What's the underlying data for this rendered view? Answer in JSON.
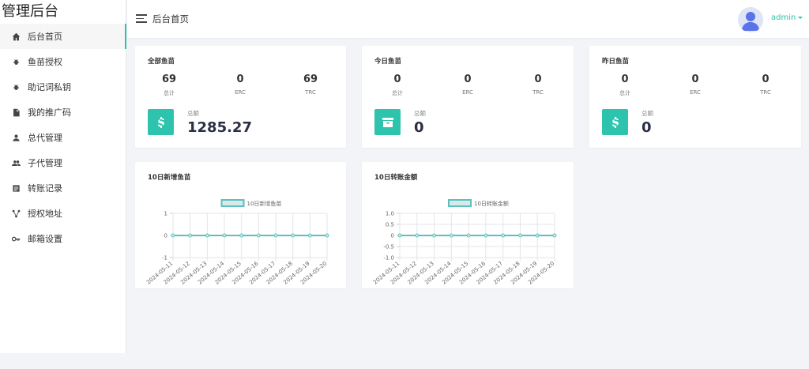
{
  "app": {
    "title": "管理后台"
  },
  "sidebar": {
    "items": [
      {
        "label": "后台首页",
        "icon": "home-icon"
      },
      {
        "label": "鱼苗授权",
        "icon": "bug-icon"
      },
      {
        "label": "助记词私钥",
        "icon": "bug-icon"
      },
      {
        "label": "我的推广码",
        "icon": "file-icon"
      },
      {
        "label": "总代管理",
        "icon": "user-icon"
      },
      {
        "label": "子代管理",
        "icon": "users-icon"
      },
      {
        "label": "转账记录",
        "icon": "list-icon"
      },
      {
        "label": "授权地址",
        "icon": "share-icon"
      },
      {
        "label": "邮箱设置",
        "icon": "key-icon"
      }
    ]
  },
  "header": {
    "page_title": "后台首页",
    "username": "admin"
  },
  "cards": [
    {
      "title": "全部鱼苗",
      "stats": [
        {
          "value": "69",
          "label": "总计"
        },
        {
          "value": "0",
          "label": "ERC"
        },
        {
          "value": "69",
          "label": "TRC"
        }
      ],
      "sum_label": "总额",
      "sum_value": "1285.27",
      "icon": "dollar-icon"
    },
    {
      "title": "今日鱼苗",
      "stats": [
        {
          "value": "0",
          "label": "总计"
        },
        {
          "value": "0",
          "label": "ERC"
        },
        {
          "value": "0",
          "label": "TRC"
        }
      ],
      "sum_label": "总额",
      "sum_value": "0",
      "icon": "archive-icon"
    },
    {
      "title": "昨日鱼苗",
      "stats": [
        {
          "value": "0",
          "label": "总计"
        },
        {
          "value": "0",
          "label": "ERC"
        },
        {
          "value": "0",
          "label": "TRC"
        }
      ],
      "sum_label": "总额",
      "sum_value": "0",
      "icon": "dollar-icon"
    }
  ],
  "colors": {
    "accent": "#2dc3ad",
    "line": "#5bc0be",
    "legend_fill": "#d7e9e8"
  },
  "chart_data": [
    {
      "type": "line",
      "title": "10日新增鱼苗",
      "categories": [
        "2024-05-11",
        "2024-05-12",
        "2024-05-13",
        "2024-05-14",
        "2024-05-15",
        "2024-05-16",
        "2024-05-17",
        "2024-05-18",
        "2024-05-19",
        "2024-05-20"
      ],
      "series": [
        {
          "name": "10日新增鱼苗",
          "values": [
            0,
            0,
            0,
            0,
            0,
            0,
            0,
            0,
            0,
            0
          ]
        }
      ],
      "yticks": [
        "1",
        "0",
        "-1"
      ],
      "ylim": [
        -1,
        1
      ],
      "grid": true,
      "legend": "top-center"
    },
    {
      "type": "line",
      "title": "10日转账金额",
      "categories": [
        "2024-05-11",
        "2024-05-12",
        "2024-05-13",
        "2024-05-14",
        "2024-05-15",
        "2024-05-16",
        "2024-05-17",
        "2024-05-18",
        "2024-05-19",
        "2024-05-20"
      ],
      "series": [
        {
          "name": "10日转账金额",
          "values": [
            0,
            0,
            0,
            0,
            0,
            0,
            0,
            0,
            0,
            0
          ]
        }
      ],
      "yticks": [
        "1.0",
        "0.5",
        "0",
        "-0.5",
        "-1.0"
      ],
      "ylim": [
        -1,
        1
      ],
      "grid": true,
      "legend": "top-center"
    }
  ]
}
